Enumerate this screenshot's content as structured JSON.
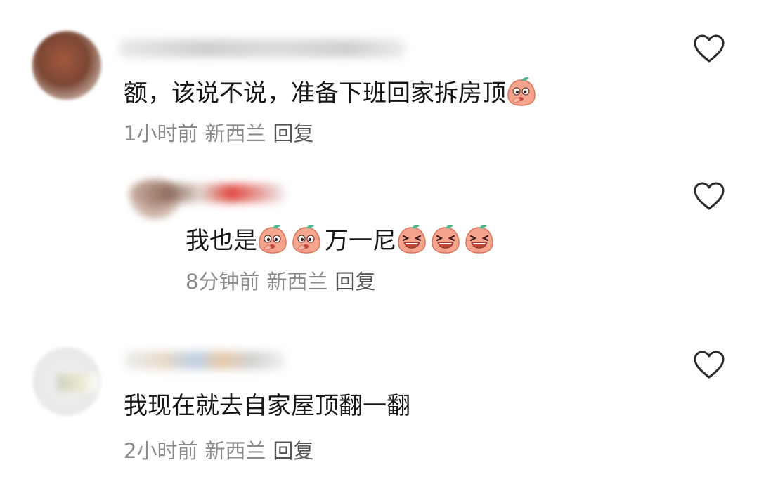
{
  "comments": [
    {
      "text": "额，该说不说，准备下班回家拆房顶",
      "emojis": [
        "peach-blush-emoji"
      ],
      "time": "1小时前",
      "location": "新西兰",
      "reply_label": "回复"
    },
    {
      "text_a": "我也是",
      "emojis_a": [
        "peach-blush-emoji",
        "peach-blush-emoji"
      ],
      "text_b": "万一尼",
      "emojis_b": [
        "peach-laugh-emoji",
        "peach-laugh-emoji",
        "peach-laugh-emoji"
      ],
      "time": "8分钟前",
      "location": "新西兰",
      "reply_label": "回复"
    },
    {
      "text": "我现在就去自家屋顶翻一翻",
      "time": "2小时前",
      "location": "新西兰",
      "reply_label": "回复"
    }
  ],
  "icons": {
    "like": "heart-outline-icon"
  },
  "colors": {
    "text": "#161616",
    "meta": "#8a8a8a",
    "peach": "#f6a48e",
    "leaf": "#49b88a"
  }
}
